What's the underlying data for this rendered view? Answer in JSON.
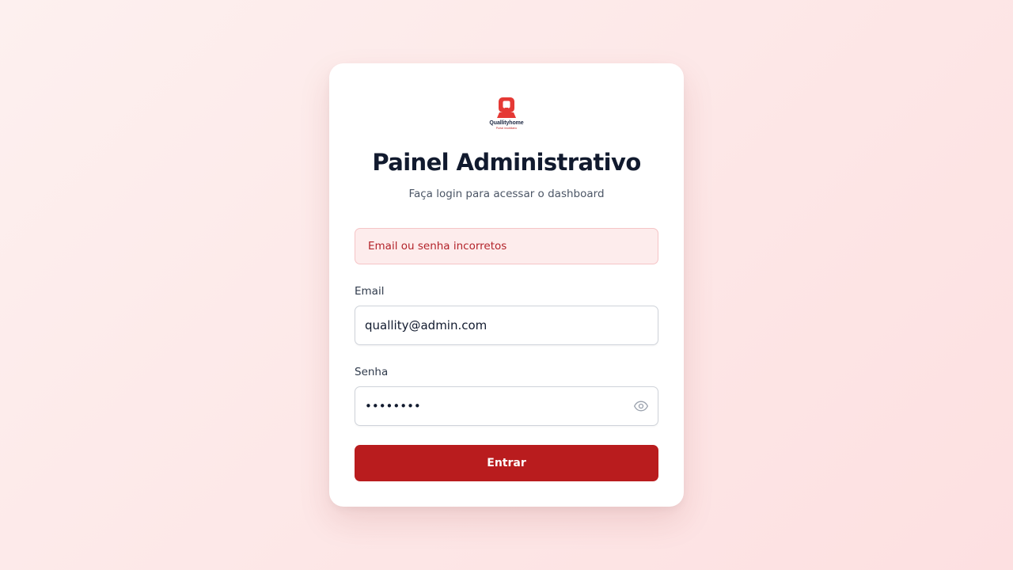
{
  "brand": {
    "logo_text": "Quallityhome",
    "logo_subtext": "Portal imobiliário",
    "accent_color": "#b91c1e"
  },
  "header": {
    "title": "Painel Administrativo",
    "subtitle": "Faça login para acessar o dashboard"
  },
  "alert": {
    "message": "Email ou senha incorretos"
  },
  "form": {
    "email": {
      "label": "Email",
      "value": "quallity@admin.com"
    },
    "password": {
      "label": "Senha",
      "value": "••••••••",
      "toggle_icon": "eye-icon"
    },
    "submit_label": "Entrar"
  }
}
